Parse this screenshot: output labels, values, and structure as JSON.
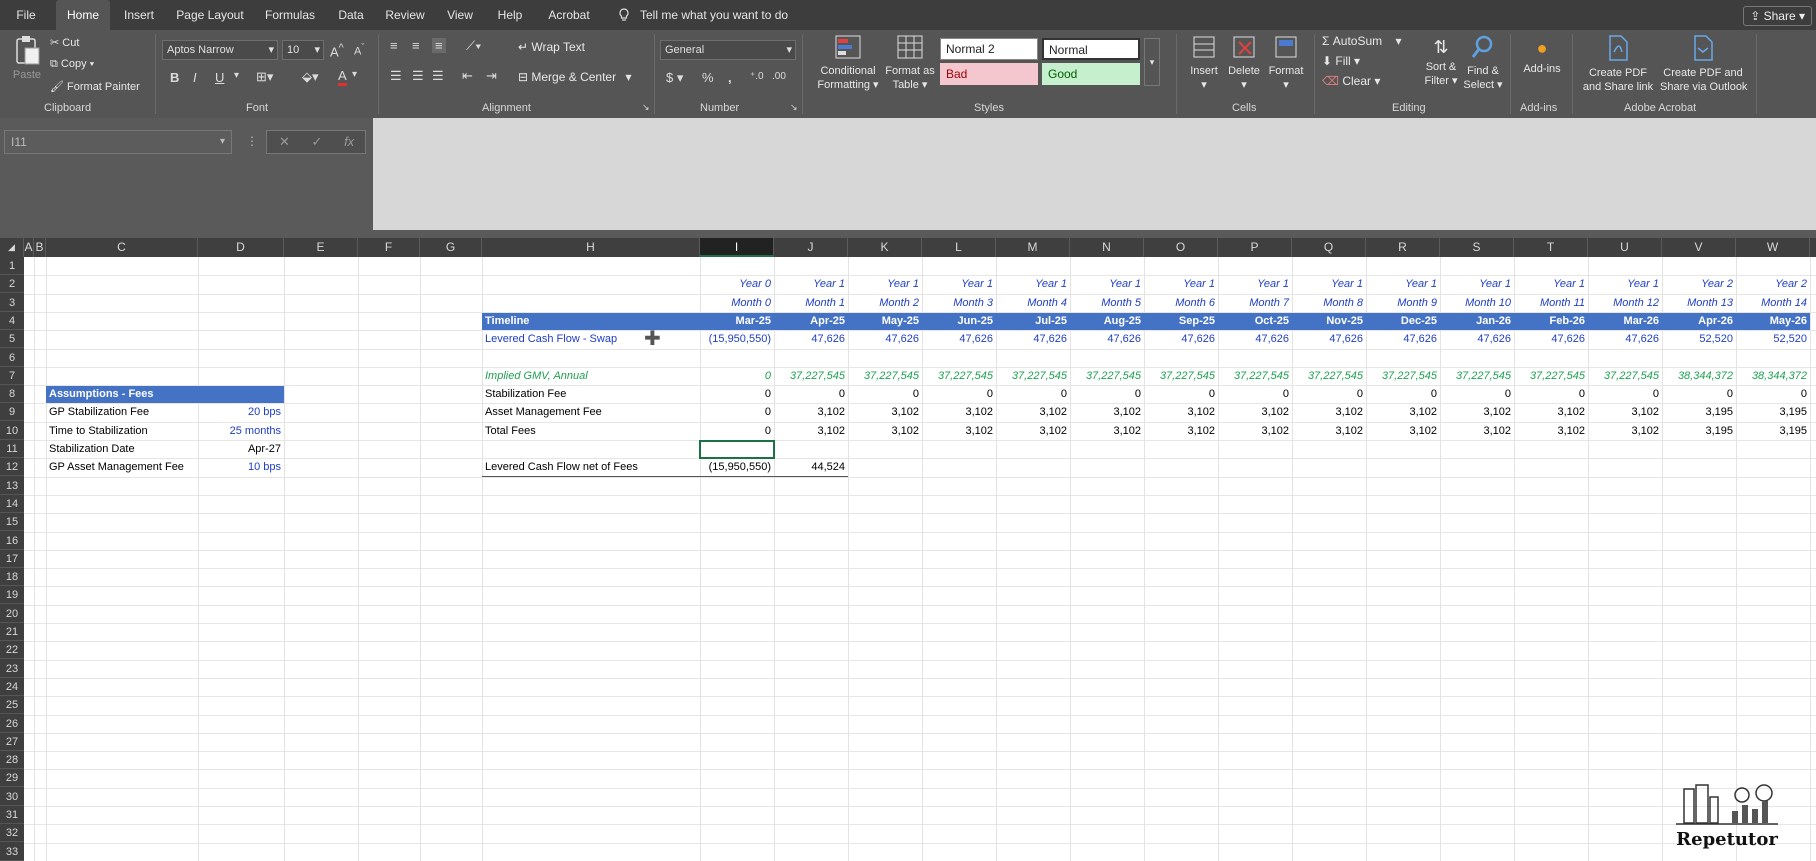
{
  "menu": {
    "tabs": [
      "File",
      "Home",
      "Insert",
      "Page Layout",
      "Formulas",
      "Data",
      "Review",
      "View",
      "Help",
      "Acrobat"
    ],
    "active": "Home",
    "tell_me": "Tell me what you want to do",
    "share": "Share"
  },
  "ribbon": {
    "clipboard": {
      "paste": "Paste",
      "cut": "Cut",
      "copy": "Copy",
      "format_painter": "Format Painter",
      "label": "Clipboard"
    },
    "font": {
      "name": "Aptos Narrow",
      "size": "10",
      "bold": "B",
      "italic": "I",
      "underline": "U",
      "label": "Font"
    },
    "alignment": {
      "wrap": "Wrap Text",
      "merge": "Merge & Center",
      "label": "Alignment"
    },
    "number": {
      "format": "General",
      "currency": "$",
      "percent": "%",
      "comma": ",",
      "label": "Number"
    },
    "styles": {
      "conditional": "Conditional",
      "conditional2": "Formatting",
      "format_table": "Format as",
      "format_table2": "Table",
      "normal2": "Normal 2",
      "normal": "Normal",
      "bad": "Bad",
      "good": "Good",
      "label": "Styles"
    },
    "cells": {
      "insert": "Insert",
      "delete": "Delete",
      "format": "Format",
      "label": "Cells"
    },
    "editing": {
      "autosum": "AutoSum",
      "fill": "Fill",
      "clear": "Clear",
      "sort": "Sort &",
      "sort2": "Filter",
      "find": "Find &",
      "find2": "Select",
      "label": "Editing"
    },
    "addins": {
      "addins": "Add-ins",
      "label": "Add-ins"
    },
    "acrobat": {
      "create_link": "Create PDF",
      "create_link2": "and Share link",
      "create_outlook": "Create PDF and",
      "create_outlook2": "Share via Outlook",
      "label": "Adobe Acrobat"
    },
    "colors": {
      "bad_bg": "#f4c7ce",
      "bad_fg": "#9c0006",
      "good_bg": "#c6efce",
      "good_fg": "#006100"
    }
  },
  "formula_bar": {
    "name_box": "I11",
    "cancel": "✕",
    "enter": "✓",
    "fx": "fx"
  },
  "columns": [
    "A",
    "B",
    "C",
    "D",
    "E",
    "F",
    "G",
    "H",
    "I",
    "J",
    "K",
    "L",
    "M",
    "N",
    "O",
    "P",
    "Q",
    "R",
    "S",
    "T",
    "U",
    "V",
    "W"
  ],
  "selected_column": "I",
  "rows": [
    "1",
    "2",
    "3",
    "4",
    "5",
    "6",
    "7",
    "8",
    "9",
    "10",
    "11",
    "12",
    "13",
    "14",
    "15",
    "16",
    "17",
    "18",
    "19",
    "20",
    "21",
    "22",
    "23",
    "24",
    "25",
    "26",
    "27",
    "28",
    "29",
    "30",
    "31",
    "32",
    "33"
  ],
  "sheet": {
    "years": [
      "Year 0",
      "Year 1",
      "Year 1",
      "Year 1",
      "Year 1",
      "Year 1",
      "Year 1",
      "Year 1",
      "Year 1",
      "Year 1",
      "Year 1",
      "Year 1",
      "Year 1",
      "Year 2",
      "Year 2"
    ],
    "months": [
      "Month 0",
      "Month 1",
      "Month 2",
      "Month 3",
      "Month 4",
      "Month 5",
      "Month 6",
      "Month 7",
      "Month 8",
      "Month 9",
      "Month 10",
      "Month 11",
      "Month 12",
      "Month 13",
      "Month 14"
    ],
    "timeline_label": "Timeline",
    "dates": [
      "Mar-25",
      "Apr-25",
      "May-25",
      "Jun-25",
      "Jul-25",
      "Aug-25",
      "Sep-25",
      "Oct-25",
      "Nov-25",
      "Dec-25",
      "Jan-26",
      "Feb-26",
      "Mar-26",
      "Apr-26",
      "May-26"
    ],
    "levered_label": "Levered Cash Flow - Swap",
    "levered": [
      "(15,950,550)",
      "47,626",
      "47,626",
      "47,626",
      "47,626",
      "47,626",
      "47,626",
      "47,626",
      "47,626",
      "47,626",
      "47,626",
      "47,626",
      "47,626",
      "52,520",
      "52,520"
    ],
    "gmv_label": "Implied GMV, Annual",
    "gmv": [
      "0",
      "37,227,545",
      "37,227,545",
      "37,227,545",
      "37,227,545",
      "37,227,545",
      "37,227,545",
      "37,227,545",
      "37,227,545",
      "37,227,545",
      "37,227,545",
      "37,227,545",
      "37,227,545",
      "38,344,372",
      "38,344,372"
    ],
    "stab_label": "Stabilization Fee",
    "stab": [
      "0",
      "0",
      "0",
      "0",
      "0",
      "0",
      "0",
      "0",
      "0",
      "0",
      "0",
      "0",
      "0",
      "0",
      "0"
    ],
    "am_label": "Asset Management Fee",
    "am": [
      "0",
      "3,102",
      "3,102",
      "3,102",
      "3,102",
      "3,102",
      "3,102",
      "3,102",
      "3,102",
      "3,102",
      "3,102",
      "3,102",
      "3,102",
      "3,195",
      "3,195"
    ],
    "total_label": "Total Fees",
    "total": [
      "0",
      "3,102",
      "3,102",
      "3,102",
      "3,102",
      "3,102",
      "3,102",
      "3,102",
      "3,102",
      "3,102",
      "3,102",
      "3,102",
      "3,102",
      "3,195",
      "3,195"
    ],
    "net_label": "Levered Cash Flow net of Fees",
    "net": [
      "(15,950,550)",
      "44,524"
    ],
    "assumptions": {
      "title": "Assumptions - Fees",
      "items": [
        {
          "label": "GP Stabilization Fee",
          "value": "20 bps",
          "blue": true
        },
        {
          "label": "Time to Stabilization",
          "value": "25 months",
          "blue": true
        },
        {
          "label": "Stabilization Date",
          "value": "Apr-27",
          "blue": false
        },
        {
          "label": "GP Asset Management Fee",
          "value": "10 bps",
          "blue": true
        }
      ]
    }
  },
  "watermark": {
    "brand": "Repetutor"
  }
}
